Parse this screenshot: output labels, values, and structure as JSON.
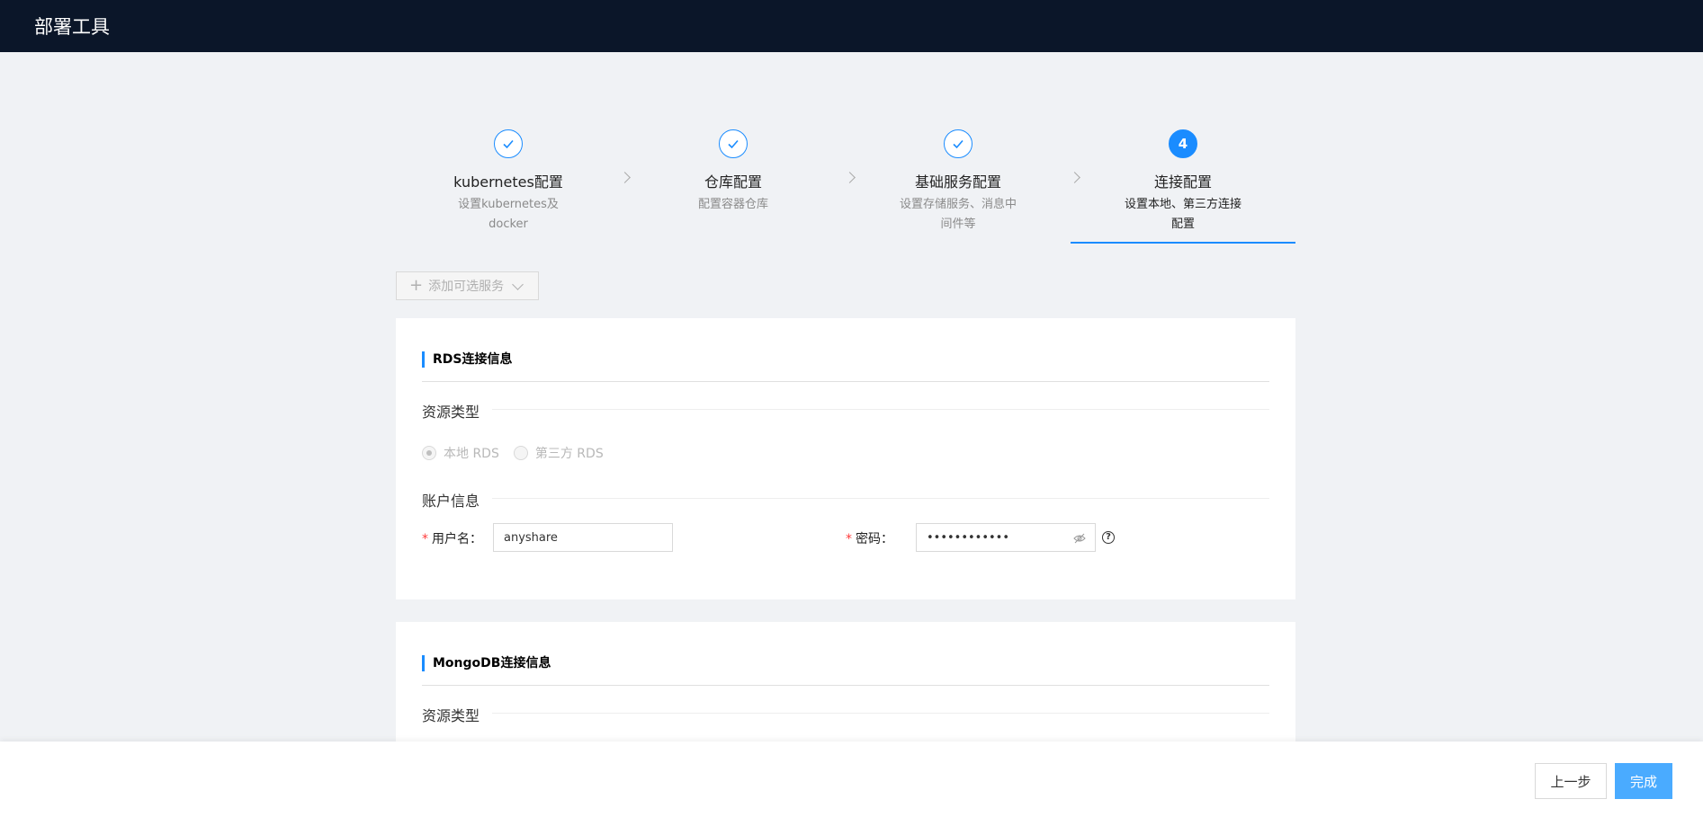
{
  "app": {
    "title": "部署工具"
  },
  "steps": [
    {
      "title": "kubernetes配置",
      "desc": "设置kubernetes及docker",
      "state": "done"
    },
    {
      "title": "仓库配置",
      "desc": "配置容器仓库",
      "state": "done"
    },
    {
      "title": "基础服务配置",
      "desc": "设置存储服务、消息中间件等",
      "state": "done"
    },
    {
      "number": "4",
      "title": "连接配置",
      "desc": "设置本地、第三方连接配置",
      "state": "active"
    }
  ],
  "toolbar": {
    "add_optional_service": "添加可选服务"
  },
  "rds": {
    "title": "RDS连接信息",
    "resource_type_label": "资源类型",
    "options": [
      "本地 RDS",
      "第三方 RDS"
    ],
    "selected": "本地 RDS",
    "account_label": "账户信息",
    "username_label": "用户名",
    "username_value": "anyshare",
    "password_label": "密码",
    "password_value": "••••••••••••"
  },
  "mongodb": {
    "title": "MongoDB连接信息",
    "resource_type_label": "资源类型"
  },
  "footer": {
    "prev_label": "上一步",
    "finish_label": "完成"
  },
  "colors": {
    "topbar": "#0b1629",
    "accent": "#1a8cff",
    "finish_button": "#4aabff",
    "required": "#ff3b3b"
  }
}
